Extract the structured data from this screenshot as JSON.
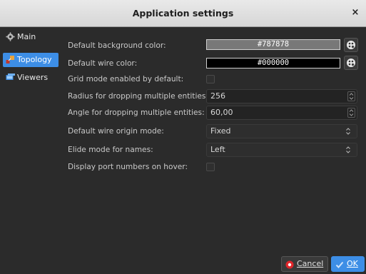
{
  "window": {
    "title": "Application settings",
    "close_glyph": "×"
  },
  "sidebar": {
    "items": [
      {
        "label": "Main",
        "icon": "gear-icon",
        "active": false
      },
      {
        "label": "Topology",
        "icon": "topology-icon",
        "active": true
      },
      {
        "label": "Viewers",
        "icon": "viewers-icon",
        "active": false
      }
    ]
  },
  "settings": {
    "bg_color": {
      "label": "Default background color:",
      "value": "#787878",
      "color": "#787878"
    },
    "wire_color": {
      "label": "Default wire color:",
      "value": "#000000",
      "color": "#000000"
    },
    "grid_mode": {
      "label": "Grid mode enabled by default:",
      "checked": false
    },
    "drop_radius": {
      "label": "Radius for dropping multiple entities:",
      "value": "256"
    },
    "drop_angle": {
      "label": "Angle for dropping multiple entities:",
      "value": "60,00"
    },
    "wire_origin": {
      "label": "Default wire origin mode:",
      "value": "Fixed"
    },
    "elide_mode": {
      "label": "Elide mode for names:",
      "value": "Left"
    },
    "port_numbers": {
      "label": "Display port numbers on hover:",
      "checked": false
    }
  },
  "buttons": {
    "cancel": "Cancel",
    "ok": "OK"
  },
  "colors": {
    "accent": "#3d8ee6",
    "panel": "#2b2b2b",
    "cancel_icon": "#e0262b"
  }
}
